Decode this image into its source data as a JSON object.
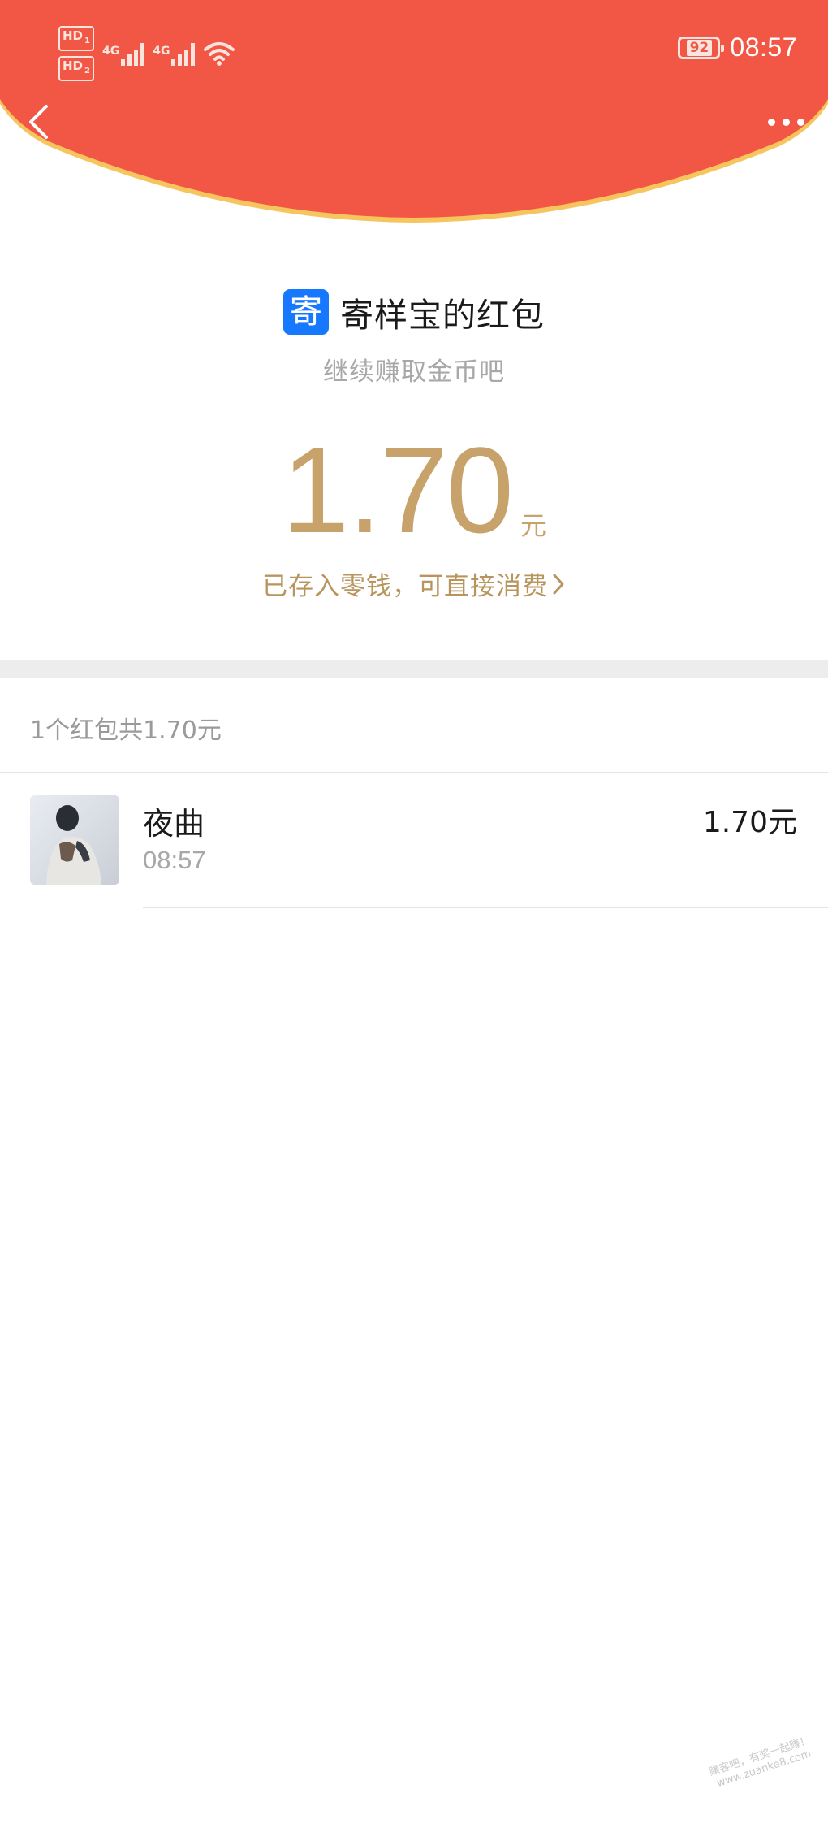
{
  "status_bar": {
    "hd1": "HD",
    "hd1_sub": "1",
    "hd2": "HD",
    "hd2_sub": "2",
    "net1": "4G",
    "net2": "4G",
    "battery": "92",
    "time": "08:57"
  },
  "header": {
    "back_icon": "chevron-left-icon",
    "more_icon": "more-dots-icon",
    "color": "#f25745",
    "rim_color": "#f7c55e"
  },
  "summary": {
    "logo_char": "寄",
    "title": "寄样宝的红包",
    "subtitle": "继续赚取金币吧",
    "amount": "1.70",
    "unit": "元",
    "wallet_link": "已存入零钱，可直接消费",
    "accent": "#c8a26b"
  },
  "records": {
    "summary_text": "1个红包共1.70元",
    "items": [
      {
        "name": "夜曲",
        "time": "08:57",
        "amount": "1.70元"
      }
    ]
  },
  "watermark": {
    "line1": "赚客吧，有奖一起赚！",
    "line2": "www.zuanke8.com"
  }
}
